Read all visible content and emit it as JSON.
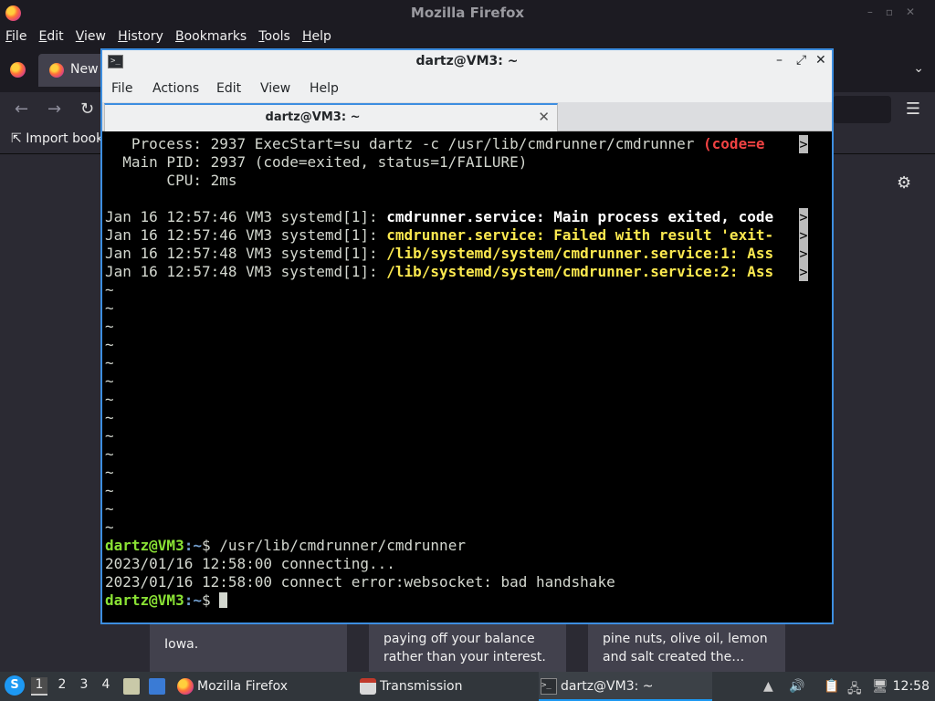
{
  "firefox": {
    "window_title": "Mozilla Firefox",
    "menu": [
      "File",
      "Edit",
      "View",
      "History",
      "Bookmarks",
      "Tools",
      "Help"
    ],
    "menu_mnemonics": [
      "F",
      "E",
      "V",
      "H",
      "B",
      "T",
      "H"
    ],
    "tab_label": "New",
    "bookmarks_import": "Import book",
    "cards": [
      {
        "line1": "",
        "line2": "Iowa."
      },
      {
        "line1": "paying off your balance",
        "line2": "rather than your interest."
      },
      {
        "line1": "pine nuts, olive oil, lemon",
        "line2": "and salt created the…"
      }
    ]
  },
  "terminal": {
    "window_title": "dartz@VM3: ~",
    "menu": [
      "File",
      "Actions",
      "Edit",
      "View",
      "Help"
    ],
    "tab_label": "dartz@VM3: ~",
    "lines": {
      "l1_plain": "   Process: 2937 ExecStart=su dartz -c /usr/lib/cmdrunner/cmdrunner ",
      "l1_red": "(code=e",
      "l2": "  Main PID: 2937 (code=exited, status=1/FAILURE)",
      "l3": "       CPU: 2ms",
      "log": [
        {
          "prefix": "Jan 16 12:57:46 VM3 systemd[1]: ",
          "msg": "cmdrunner.service: Main process exited, code",
          "style": "b"
        },
        {
          "prefix": "Jan 16 12:57:46 VM3 systemd[1]: ",
          "msg": "cmdrunner.service: Failed with result 'exit-",
          "style": "y"
        },
        {
          "prefix": "Jan 16 12:57:48 VM3 systemd[1]: ",
          "msg": "/lib/systemd/system/cmdrunner.service:1: Ass",
          "style": "y"
        },
        {
          "prefix": "Jan 16 12:57:48 VM3 systemd[1]: ",
          "msg": "/lib/systemd/system/cmdrunner.service:2: Ass",
          "style": "y"
        }
      ],
      "tilde": "~",
      "prompt_user": "dartz@VM3",
      "prompt_path": ":~",
      "prompt_sign": "$ ",
      "command": "/usr/lib/cmdrunner/cmdrunner",
      "out1": "2023/01/16 12:58:00 connecting...",
      "out2": "2023/01/16 12:58:00 connect error:websocket: bad handshake",
      "trunc_marker": ">"
    }
  },
  "taskbar": {
    "workspaces": [
      "1",
      "2",
      "3",
      "4"
    ],
    "active_workspace": 0,
    "apps": [
      {
        "label": "Mozilla Firefox"
      },
      {
        "label": "Transmission"
      },
      {
        "label": "dartz@VM3: ~"
      }
    ],
    "clock": "12:58"
  },
  "colors": {
    "terminal_accent": "#3d8ee0",
    "prompt_green": "#8ae234",
    "prompt_blue": "#729fcf",
    "error_red": "#ef4242",
    "log_yellow": "#fce94f"
  }
}
